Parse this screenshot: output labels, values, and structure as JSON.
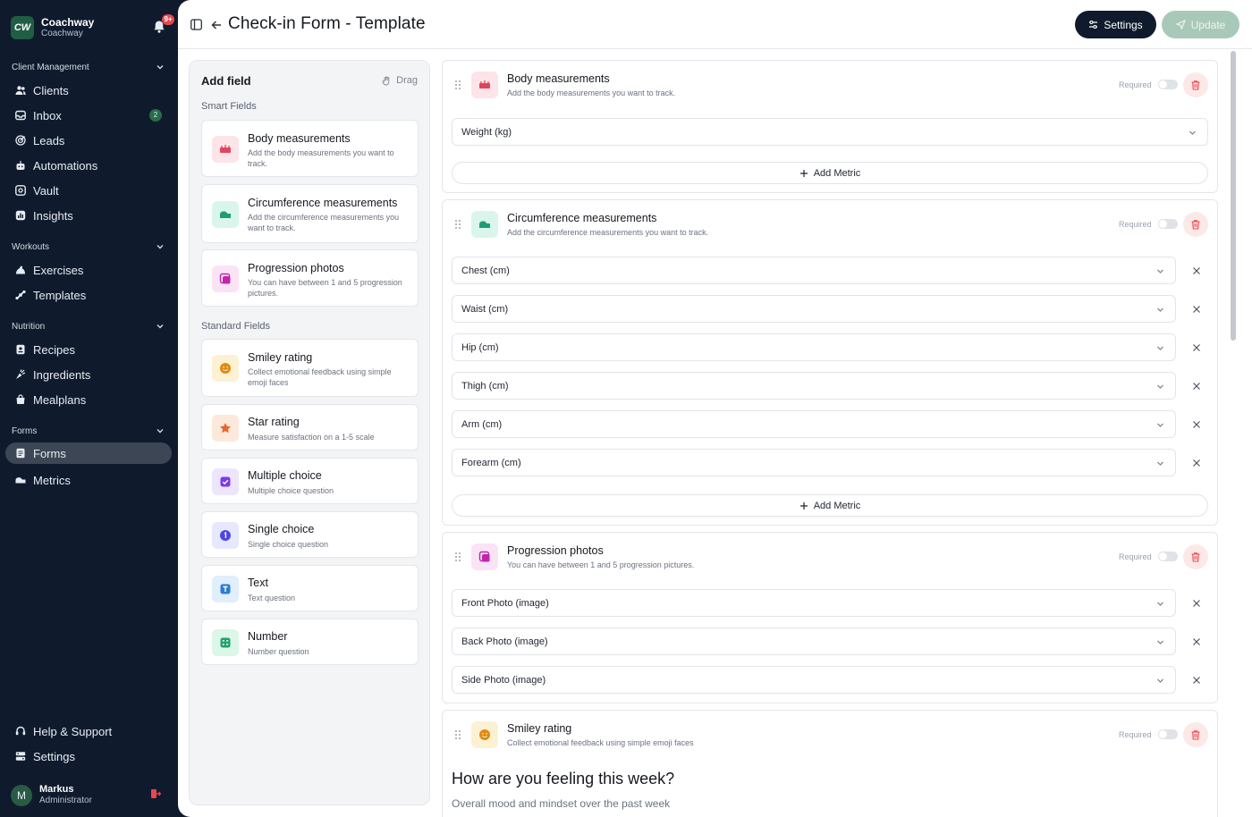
{
  "brand": {
    "name": "Coachway",
    "sub": "Coachway",
    "logo_text": "CW",
    "notification_badge": "9+"
  },
  "sidebar": {
    "sections": [
      {
        "title": "Client Management",
        "items": [
          {
            "label": "Clients",
            "icon": "users-icon"
          },
          {
            "label": "Inbox",
            "icon": "inbox-icon",
            "badge": "2"
          },
          {
            "label": "Leads",
            "icon": "target-icon"
          },
          {
            "label": "Automations",
            "icon": "bot-icon"
          },
          {
            "label": "Vault",
            "icon": "vault-icon"
          },
          {
            "label": "Insights",
            "icon": "chart-icon"
          }
        ]
      },
      {
        "title": "Workouts",
        "items": [
          {
            "label": "Exercises",
            "icon": "dumbbell-icon"
          },
          {
            "label": "Templates",
            "icon": "template-icon"
          }
        ]
      },
      {
        "title": "Nutrition",
        "items": [
          {
            "label": "Recipes",
            "icon": "book-icon"
          },
          {
            "label": "Ingredients",
            "icon": "carrot-icon"
          },
          {
            "label": "Mealplans",
            "icon": "bag-icon"
          }
        ]
      },
      {
        "title": "Forms",
        "items": [
          {
            "label": "Forms",
            "icon": "clipboard-icon",
            "active": true
          },
          {
            "label": "Metrics",
            "icon": "ruler-icon"
          }
        ]
      }
    ],
    "footer": [
      {
        "label": "Help & Support",
        "icon": "headset-icon"
      },
      {
        "label": "Settings",
        "icon": "gear-icon"
      }
    ],
    "user": {
      "initial": "M",
      "name": "Markus",
      "role": "Administrator"
    }
  },
  "header": {
    "title": "Check-in Form - Template",
    "settings_label": "Settings",
    "update_label": "Update"
  },
  "add_field": {
    "title": "Add field",
    "drag_hint": "Drag",
    "smart_label": "Smart Fields",
    "standard_label": "Standard Fields",
    "smart": [
      {
        "title": "Body measurements",
        "desc": "Add the body measurements you want to track.",
        "color": "#fde4e8",
        "icon_color": "#e0455f"
      },
      {
        "title": "Circumference measurements",
        "desc": "Add the circumference measurements you want to track.",
        "color": "#d9f5ec",
        "icon_color": "#1f9d78"
      },
      {
        "title": "Progression photos",
        "desc": "You can have between 1 and 5 progression pictures.",
        "color": "#fbe3f6",
        "icon_color": "#c026a9"
      }
    ],
    "standard": [
      {
        "title": "Smiley rating",
        "desc": "Collect emotional feedback using simple emoji faces",
        "color": "#fdf1d3",
        "icon_color": "#e08a14"
      },
      {
        "title": "Star rating",
        "desc": "Measure satisfaction on a 1-5 scale",
        "color": "#fde9dc",
        "icon_color": "#e4682c"
      },
      {
        "title": "Multiple choice",
        "desc": "Multiple choice question",
        "color": "#ece6fd",
        "icon_color": "#7c3aed"
      },
      {
        "title": "Single choice",
        "desc": "Single choice question",
        "color": "#e6e8fd",
        "icon_color": "#4f46e5"
      },
      {
        "title": "Text",
        "desc": "Text question",
        "color": "#e1eefc",
        "icon_color": "#2b7bd6"
      },
      {
        "title": "Number",
        "desc": "Number question",
        "color": "#dcf6e8",
        "icon_color": "#1fa36b"
      }
    ]
  },
  "blocks": {
    "required_label": "Required",
    "add_metric_label": "Add Metric",
    "body": {
      "title": "Body measurements",
      "desc": "Add the body measurements you want to track.",
      "metrics": [
        "Weight (kg)"
      ]
    },
    "circumference": {
      "title": "Circumference measurements",
      "desc": "Add the circumference measurements you want to track.",
      "metrics": [
        "Chest (cm)",
        "Waist (cm)",
        "Hip (cm)",
        "Thigh (cm)",
        "Arm (cm)",
        "Forearm (cm)"
      ]
    },
    "photos": {
      "title": "Progression photos",
      "desc": "You can have between 1 and 5 progression pictures.",
      "metrics": [
        "Front Photo (image)",
        "Back Photo (image)",
        "Side Photo (image)"
      ]
    },
    "smiley": {
      "title": "Smiley rating",
      "desc": "Collect emotional feedback using simple emoji faces",
      "question": "How are you feeling this week?",
      "sub": "Overall mood and mindset over the past week"
    }
  }
}
